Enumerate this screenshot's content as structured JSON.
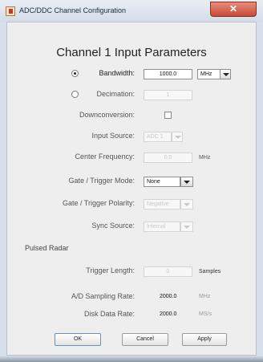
{
  "window": {
    "title": "ADC/DDC Channel Configuration",
    "close_label": "✕"
  },
  "heading": "Channel 1 Input Parameters",
  "bandwidth": {
    "label": "Bandwidth:",
    "value": "1000.0",
    "unit": "MHz",
    "selected": true
  },
  "decimation": {
    "label": "Decimation:",
    "value": "1",
    "selected": false
  },
  "downconversion": {
    "label": "Downconversion:",
    "checked": false
  },
  "input_source": {
    "label": "Input Source:",
    "value": "ADC 1"
  },
  "center_frequency": {
    "label": "Center Frequency:",
    "value": "0.0",
    "unit": "MHz"
  },
  "gate_trigger_mode": {
    "label": "Gate / Trigger Mode:",
    "value": "None"
  },
  "gate_trigger_polarity": {
    "label": "Gate / Trigger Polarity:",
    "value": "Negative"
  },
  "sync_source": {
    "label": "Sync Source:",
    "value": "Internal"
  },
  "pulsed_radar": {
    "label": "Pulsed Radar"
  },
  "trigger_length": {
    "label": "Trigger Length:",
    "value": "0",
    "unit": "Samples"
  },
  "ad_sampling_rate": {
    "label": "A/D Sampling Rate:",
    "value": "2000.0",
    "unit": "MHz"
  },
  "disk_data_rate": {
    "label": "Disk Data Rate:",
    "value": "2000.0",
    "unit": "MS/s"
  },
  "buttons": {
    "ok": "OK",
    "cancel": "Cancel",
    "apply": "Apply"
  }
}
